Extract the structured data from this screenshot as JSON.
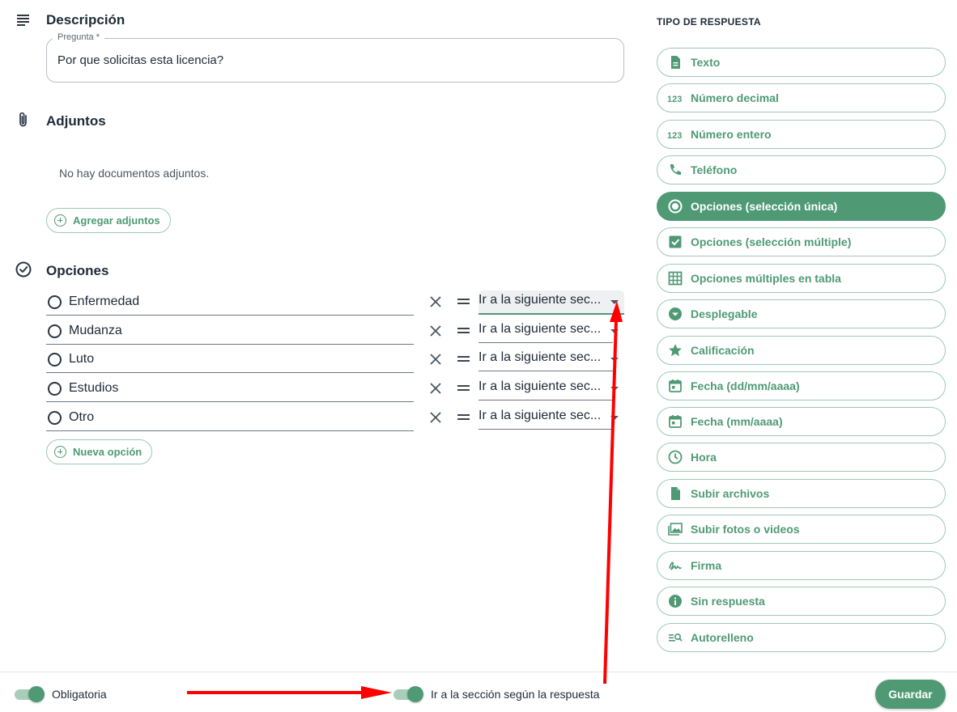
{
  "description": {
    "title": "Descripción",
    "question_legend": "Pregunta *",
    "question_value": "Por que solicitas esta licencia?"
  },
  "attachments": {
    "title": "Adjuntos",
    "empty_text": "No hay documentos adjuntos.",
    "add_label": "Agregar adjuntos"
  },
  "options": {
    "title": "Opciones",
    "items": [
      {
        "label": "Enfermedad",
        "target": "Ir a la siguiente sec..."
      },
      {
        "label": "Mudanza",
        "target": "Ir a la siguiente sec..."
      },
      {
        "label": "Luto",
        "target": "Ir a la siguiente sec..."
      },
      {
        "label": "Estudios",
        "target": "Ir a la siguiente sec..."
      },
      {
        "label": "Otro",
        "target": "Ir a la siguiente sec..."
      }
    ],
    "new_option_label": "Nueva opción"
  },
  "response_type": {
    "title": "TIPO DE RESPUESTA",
    "selected": "Opciones (selección única)",
    "items": [
      {
        "label": "Texto",
        "icon": "document-icon"
      },
      {
        "label": "Número decimal",
        "icon": "numbers-icon"
      },
      {
        "label": "Número entero",
        "icon": "numbers-icon"
      },
      {
        "label": "Teléfono",
        "icon": "phone-icon"
      },
      {
        "label": "Opciones (selección única)",
        "icon": "radio-icon"
      },
      {
        "label": "Opciones (selección múltiple)",
        "icon": "checkbox-icon"
      },
      {
        "label": "Opciones múltiples en tabla",
        "icon": "grid-icon"
      },
      {
        "label": "Desplegable",
        "icon": "dropdown-icon"
      },
      {
        "label": "Calificación",
        "icon": "star-icon"
      },
      {
        "label": "Fecha (dd/mm/aaaa)",
        "icon": "calendar-icon"
      },
      {
        "label": "Fecha (mm/aaaa)",
        "icon": "calendar-icon"
      },
      {
        "label": "Hora",
        "icon": "clock-icon"
      },
      {
        "label": "Subir archivos",
        "icon": "file-icon"
      },
      {
        "label": "Subir fotos o videos",
        "icon": "photos-icon"
      },
      {
        "label": "Firma",
        "icon": "signature-icon"
      },
      {
        "label": "Sin respuesta",
        "icon": "info-icon"
      },
      {
        "label": "Autorelleno",
        "icon": "autofill-icon"
      }
    ]
  },
  "footer": {
    "required_label": "Obligatoria",
    "required_on": true,
    "branching_label": "Ir a la sección según la respuesta",
    "branching_on": true,
    "save_label": "Guardar"
  },
  "colors": {
    "accent": "#4f9a75",
    "accent_light": "#9ccab2",
    "annotation": "#ff0000"
  }
}
